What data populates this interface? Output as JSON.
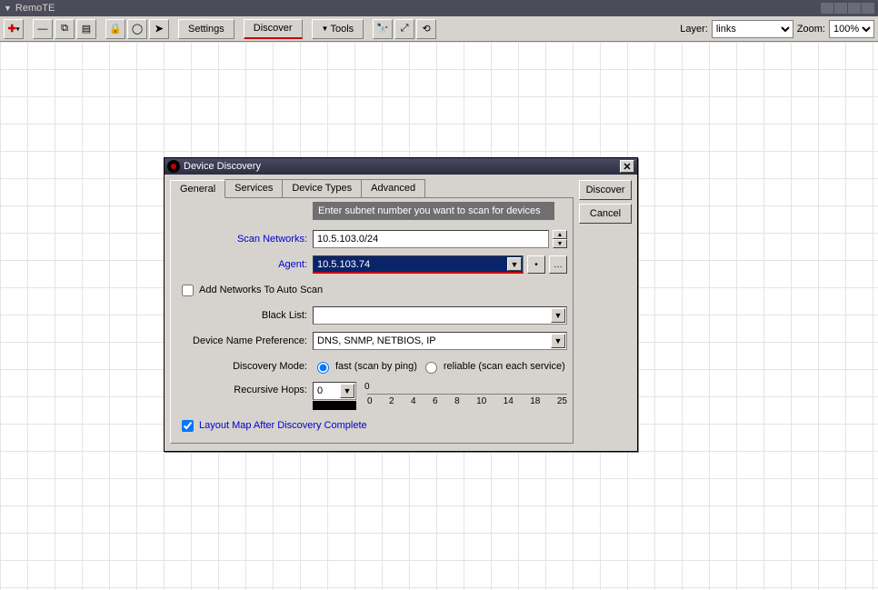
{
  "app": {
    "title": "RemoTE"
  },
  "toolbar": {
    "settings": "Settings",
    "discover": "Discover",
    "tools": "Tools",
    "layer_label": "Layer:",
    "layer_value": "links",
    "zoom_label": "Zoom:",
    "zoom_value": "100%"
  },
  "dialog": {
    "title": "Device Discovery",
    "tabs": [
      "General",
      "Services",
      "Device Types",
      "Advanced"
    ],
    "hint": "Enter subnet number you want to scan for devices",
    "labels": {
      "scan_networks": "Scan Networks:",
      "agent": "Agent:",
      "add_networks": "Add Networks To Auto Scan",
      "black_list": "Black List:",
      "device_name_pref": "Device Name Preference:",
      "discovery_mode": "Discovery Mode:",
      "recursive_hops": "Recursive Hops:",
      "layout_after": "Layout Map After Discovery Complete"
    },
    "values": {
      "scan_networks": "10.5.103.0/24",
      "agent": "10.5.103.74",
      "device_name_pref": "DNS, SNMP, NETBIOS, IP",
      "recursive_hops": "0"
    },
    "discovery_mode": {
      "fast": "fast (scan by ping)",
      "reliable": "reliable (scan each service)"
    },
    "slider_ticks": [
      "0",
      "2",
      "4",
      "6",
      "8",
      "10",
      "14",
      "18",
      "25"
    ],
    "buttons": {
      "discover": "Discover",
      "cancel": "Cancel"
    }
  }
}
